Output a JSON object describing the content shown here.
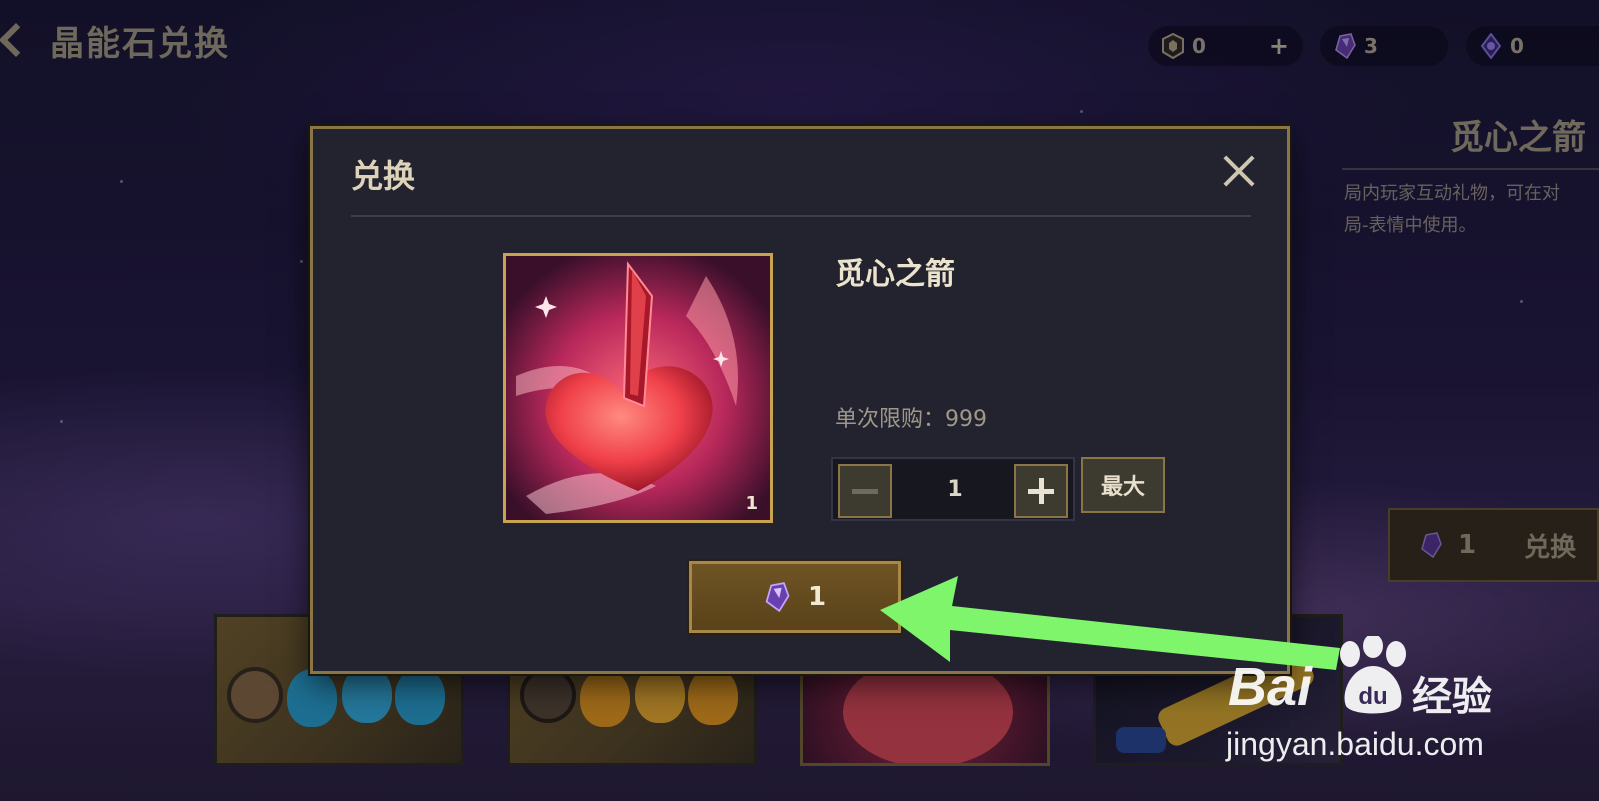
{
  "header": {
    "title": "晶能石兑换",
    "currencies": [
      {
        "icon": "gold-shield-coin-icon",
        "value": "0",
        "has_plus": true,
        "plus_label": "+"
      },
      {
        "icon": "purple-crystal-icon",
        "value": "3",
        "has_plus": false
      },
      {
        "icon": "violet-gem-icon",
        "value": "0",
        "has_plus": false
      }
    ]
  },
  "side_panel": {
    "item_title": "觅心之箭",
    "description": "局内玩家互动礼物，可在对\n局-表情中使用。",
    "exchange_cost": "1",
    "exchange_label": "兑换"
  },
  "modal": {
    "title": "兑换",
    "item": {
      "name": "觅心之箭",
      "quantity_badge": "1",
      "icon": "heart-pierced-by-arrow-icon"
    },
    "limit_text": "单次限购：999",
    "quantity_value": "1",
    "max_label": "最大",
    "confirm_cost": "1",
    "colors": {
      "accent_gold": "#c9a450",
      "panel_bg": "#22232f",
      "annotation_arrow": "#7ef56a"
    }
  },
  "watermark": {
    "brand": "Bai",
    "brand_paw": "du",
    "suffix_cn": "经验",
    "url": "jingyan.baidu.com"
  }
}
